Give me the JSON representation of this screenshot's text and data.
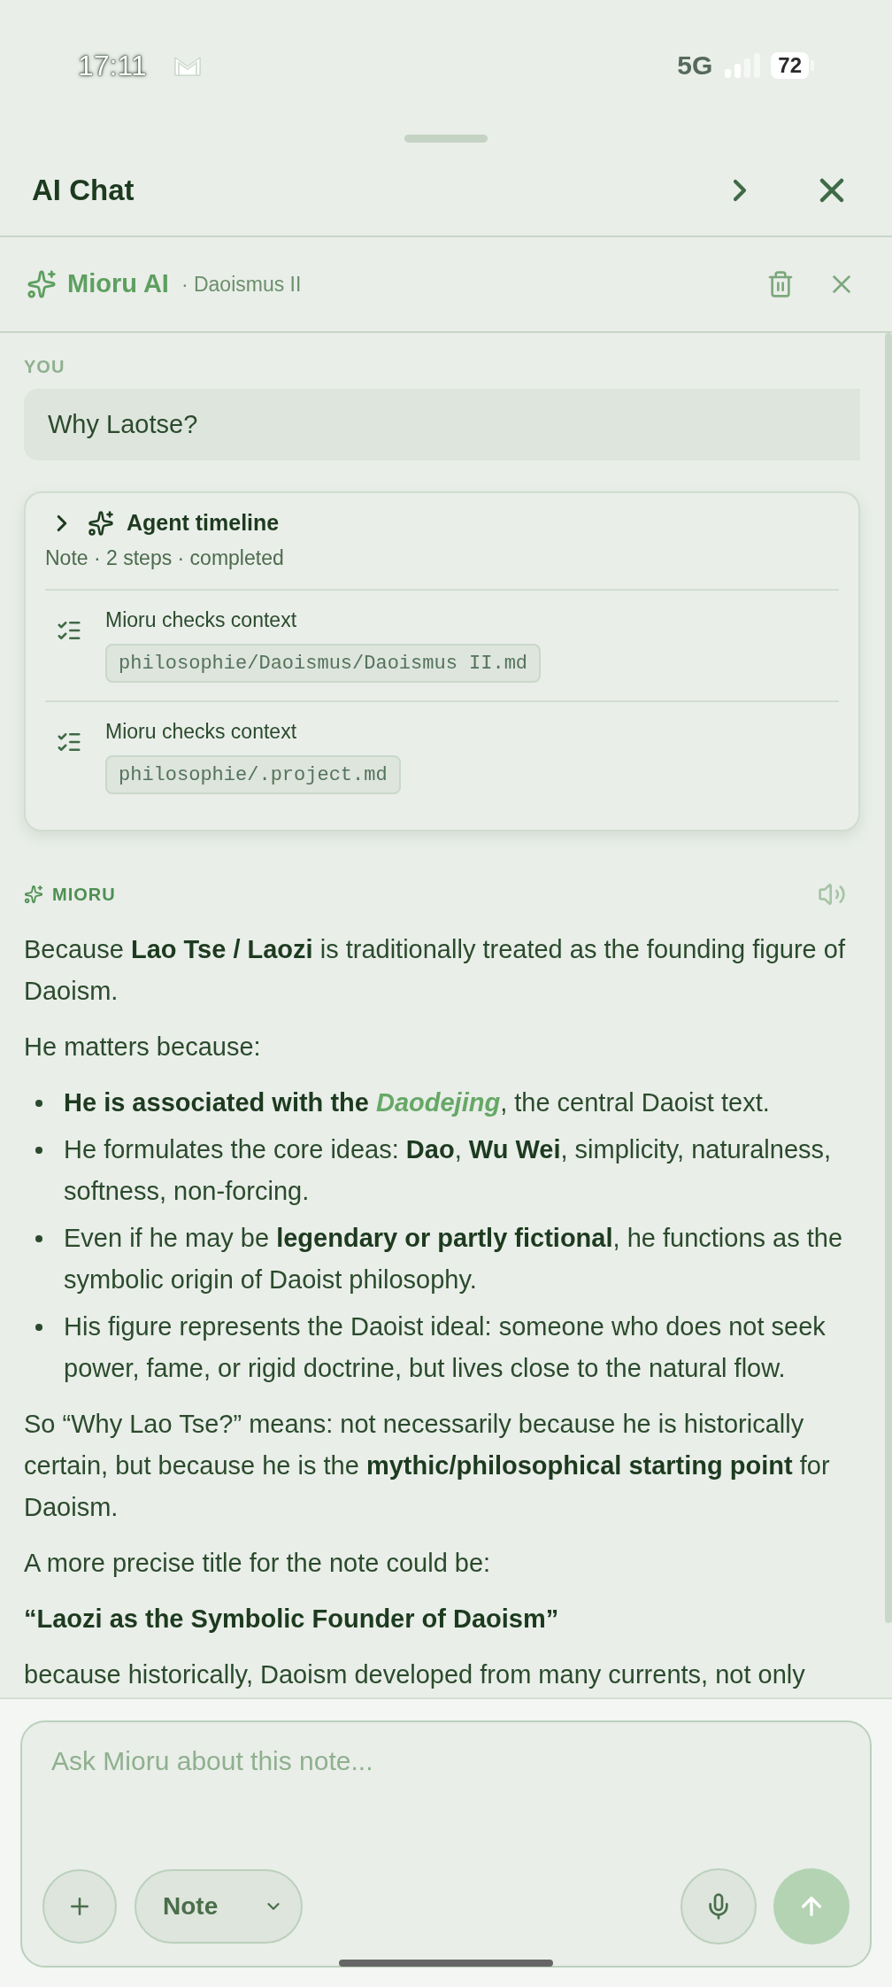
{
  "status_bar": {
    "time": "17:11",
    "network": "5G",
    "battery": "72"
  },
  "sheet": {
    "title": "AI Chat"
  },
  "chat_header": {
    "assistant": "Mioru AI",
    "context": "· Daoismus II"
  },
  "user_message": {
    "label": "YOU",
    "text": "Why Laotse?"
  },
  "agent_timeline": {
    "title": "Agent timeline",
    "summary": "Note · 2 steps · completed",
    "steps": [
      {
        "label": "Mioru checks context",
        "path": "philosophie/Daoismus/Daoismus II.md"
      },
      {
        "label": "Mioru checks context",
        "path": "philosophie/.project.md"
      }
    ]
  },
  "assistant_message": {
    "label": "MIORU",
    "blocks": [
      {
        "kind": "paragraph",
        "text": "Because **Lao Tse / Laozi** is traditionally treated as the founding figure of Daoism."
      },
      {
        "kind": "paragraph",
        "text": "He matters because:"
      },
      {
        "kind": "list",
        "items": [
          {
            "parts": [
              {
                "kind": "text",
                "text": "**He is associated with the** "
              },
              {
                "kind": "link",
                "text": "Daodejing"
              },
              {
                "kind": "text",
                "text": ", the central Daoist text."
              }
            ]
          },
          {
            "parts": [
              {
                "kind": "text",
                "text": "He formulates the core ideas: **Dao**, **Wu Wei**, simplicity, naturalness, softness, non-forcing."
              }
            ]
          },
          {
            "parts": [
              {
                "kind": "text",
                "text": "Even if he may be **legendary or partly fictional**, he functions as the symbolic origin of Daoist philosophy."
              }
            ]
          },
          {
            "parts": [
              {
                "kind": "text",
                "text": "His figure represents the Daoist ideal: someone who does not seek power, fame, or rigid doctrine, but lives close to the natural flow."
              }
            ]
          }
        ]
      },
      {
        "kind": "paragraph",
        "text": "So “Why Lao Tse?” means: not necessarily because he is historically certain, but because he is the **mythic/philosophical starting point** for Daoism."
      },
      {
        "kind": "paragraph",
        "text": "A more precise title for the note could be:"
      },
      {
        "kind": "emphasis",
        "text": "“Laozi as the Symbolic Founder of Daoism”"
      },
      {
        "kind": "paragraph",
        "text": "because historically, Daoism developed from many currents, not only"
      }
    ]
  },
  "composer": {
    "placeholder": "Ask Mioru about this note...",
    "mode": "Note",
    "send_disabled": true
  }
}
